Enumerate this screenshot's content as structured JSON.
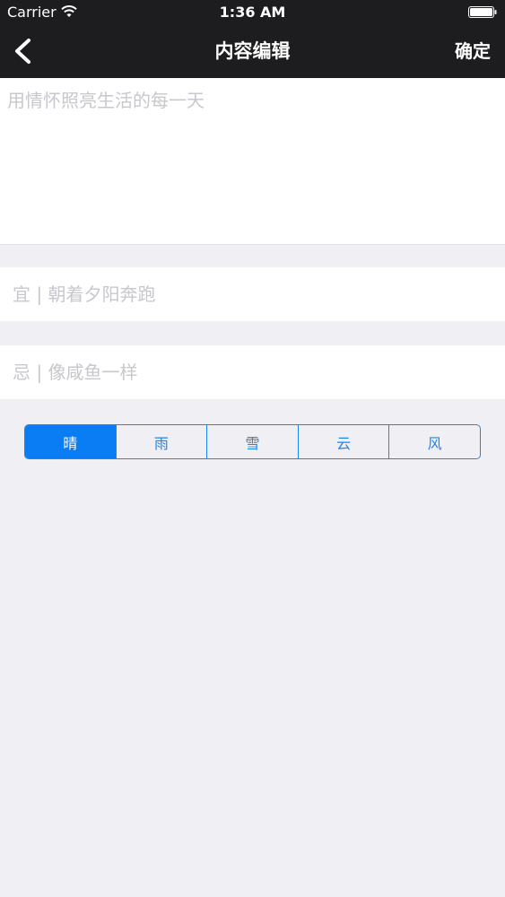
{
  "status_bar": {
    "carrier": "Carrier",
    "time": "1:36 AM"
  },
  "nav": {
    "title": "内容编辑",
    "confirm_label": "确定",
    "back_icon": "chevron-left-icon"
  },
  "editor": {
    "placeholder": "用情怀照亮生活的每一天"
  },
  "fields": {
    "yi": "宜 | 朝着夕阳奔跑",
    "ji": "忌 | 像咸鱼一样"
  },
  "weather": {
    "selected_index": 0,
    "options": [
      "晴",
      "雨",
      "雪",
      "云",
      "风"
    ]
  },
  "colors": {
    "nav_bg": "#1d1d1f",
    "accent": "#0a7df5",
    "placeholder": "#c7c7cd",
    "page_bg": "#f0eff4"
  }
}
